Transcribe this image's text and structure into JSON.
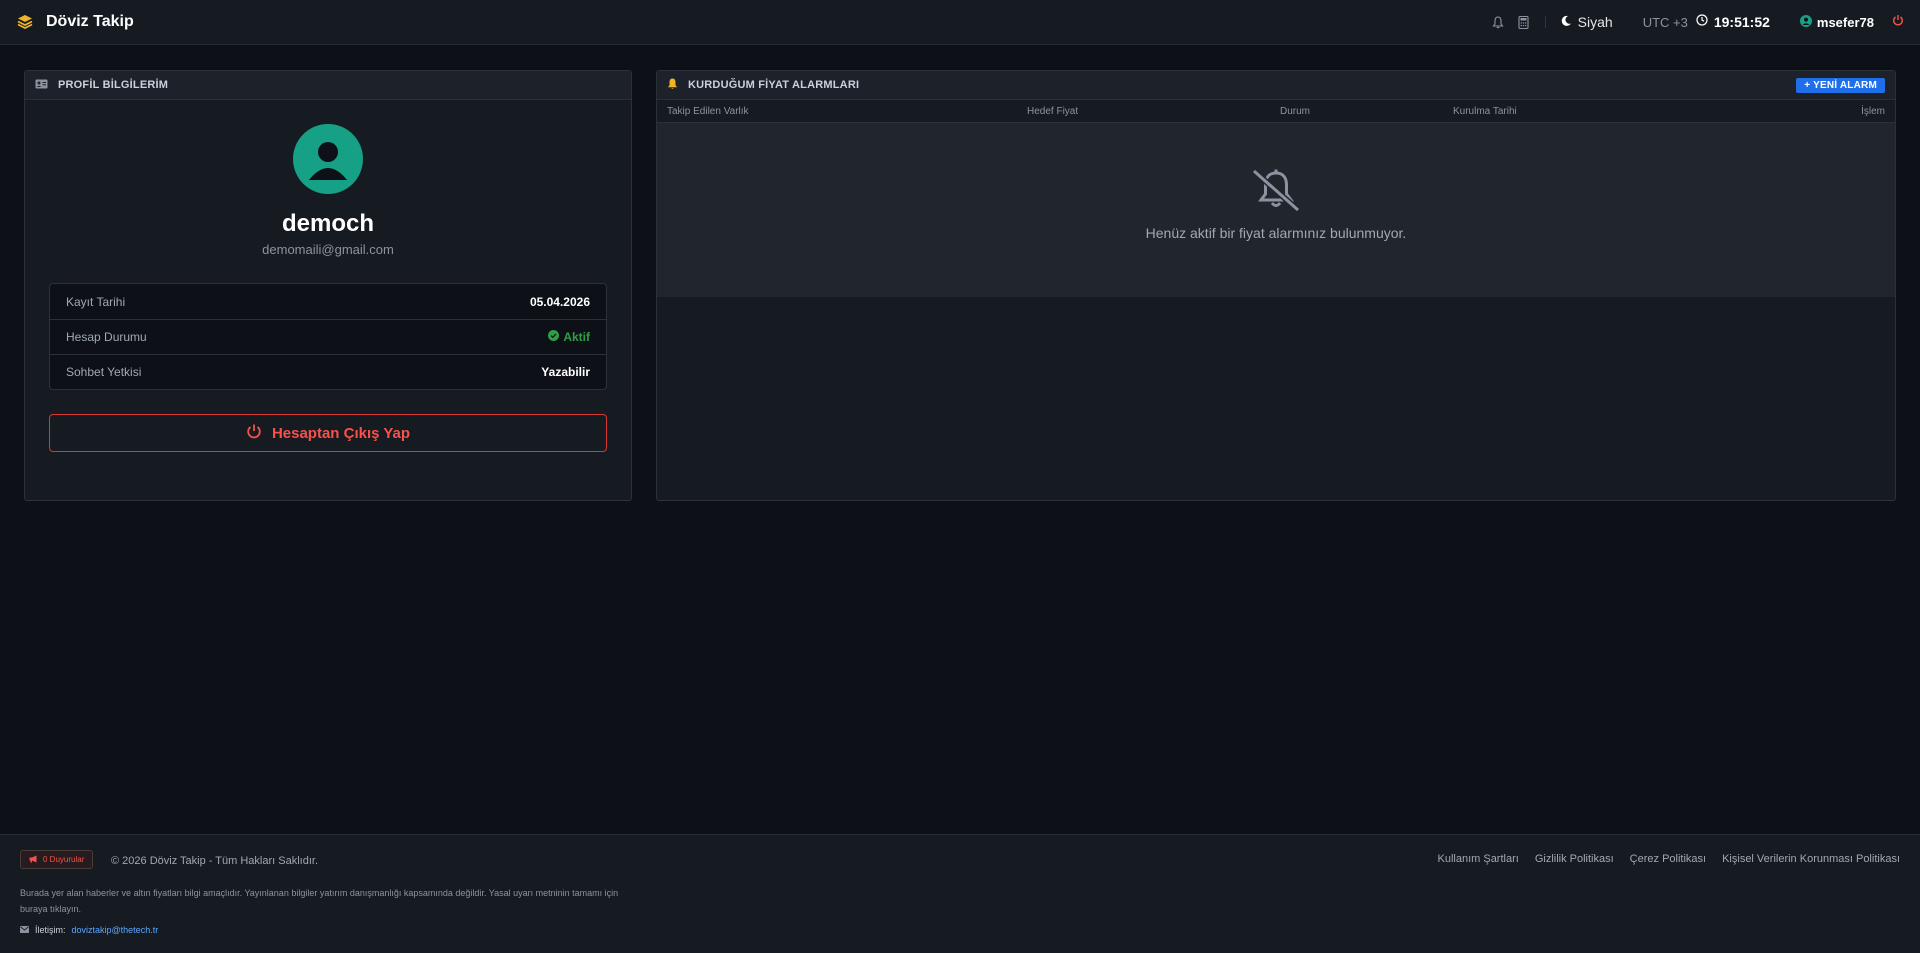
{
  "app": {
    "title": "Döviz Takip"
  },
  "topbar": {
    "theme_label": "Siyah",
    "timezone": "UTC +3",
    "time": "19:51:52",
    "username": "msefer78",
    "icons": [
      "bell-icon",
      "calculator-icon",
      "moon-icon",
      "clock-icon",
      "user-icon",
      "power-icon"
    ]
  },
  "profile": {
    "header": "PROFİL BİLGİLERİM",
    "name": "democh",
    "email": "demomaili@gmail.com",
    "rows": [
      {
        "label": "Kayıt Tarihi",
        "value": "05.04.2026"
      },
      {
        "label": "Hesap Durumu",
        "value": "Aktif"
      },
      {
        "label": "Sohbet Yetkisi",
        "value": "Yazabilir"
      }
    ],
    "logout_label": "Hesaptan Çıkış Yap",
    "colors": {
      "avatar": "#16a085",
      "status": "#2ea043",
      "logout": "#f85149"
    }
  },
  "alarms": {
    "header": "KURDUĞUM FİYAT ALARMLARI",
    "new_button": "+ YENİ ALARM",
    "columns": [
      "Takip Edilen Varlık",
      "Hedef Fiyat",
      "Durum",
      "Kurulma Tarihi",
      "İşlem"
    ],
    "empty_text": "Henüz aktif bir fiyat alarmınız bulunmuyor.",
    "colors": {
      "button": "#1f6feb",
      "bell": "#f0b429"
    }
  },
  "footer": {
    "announcements": "0 Duyurular",
    "copyright": "© 2026 Döviz Takip - Tüm Hakları Saklıdır.",
    "links": [
      "Kullanım Şartları",
      "Gizlilik Politikası",
      "Çerez Politikası",
      "Kişisel Verilerin Korunması Politikası"
    ],
    "disclaimer": "Burada yer alan haberler ve altın fiyatları bilgi amaçlıdır. Yayınlanan bilgiler yatırım danışmanlığı kapsamında değildir. Yasal uyarı metninin tamamı için buraya tıklayın.",
    "contact_label": "İletişim:",
    "contact_email": "doviztakip@thetech.tr"
  }
}
